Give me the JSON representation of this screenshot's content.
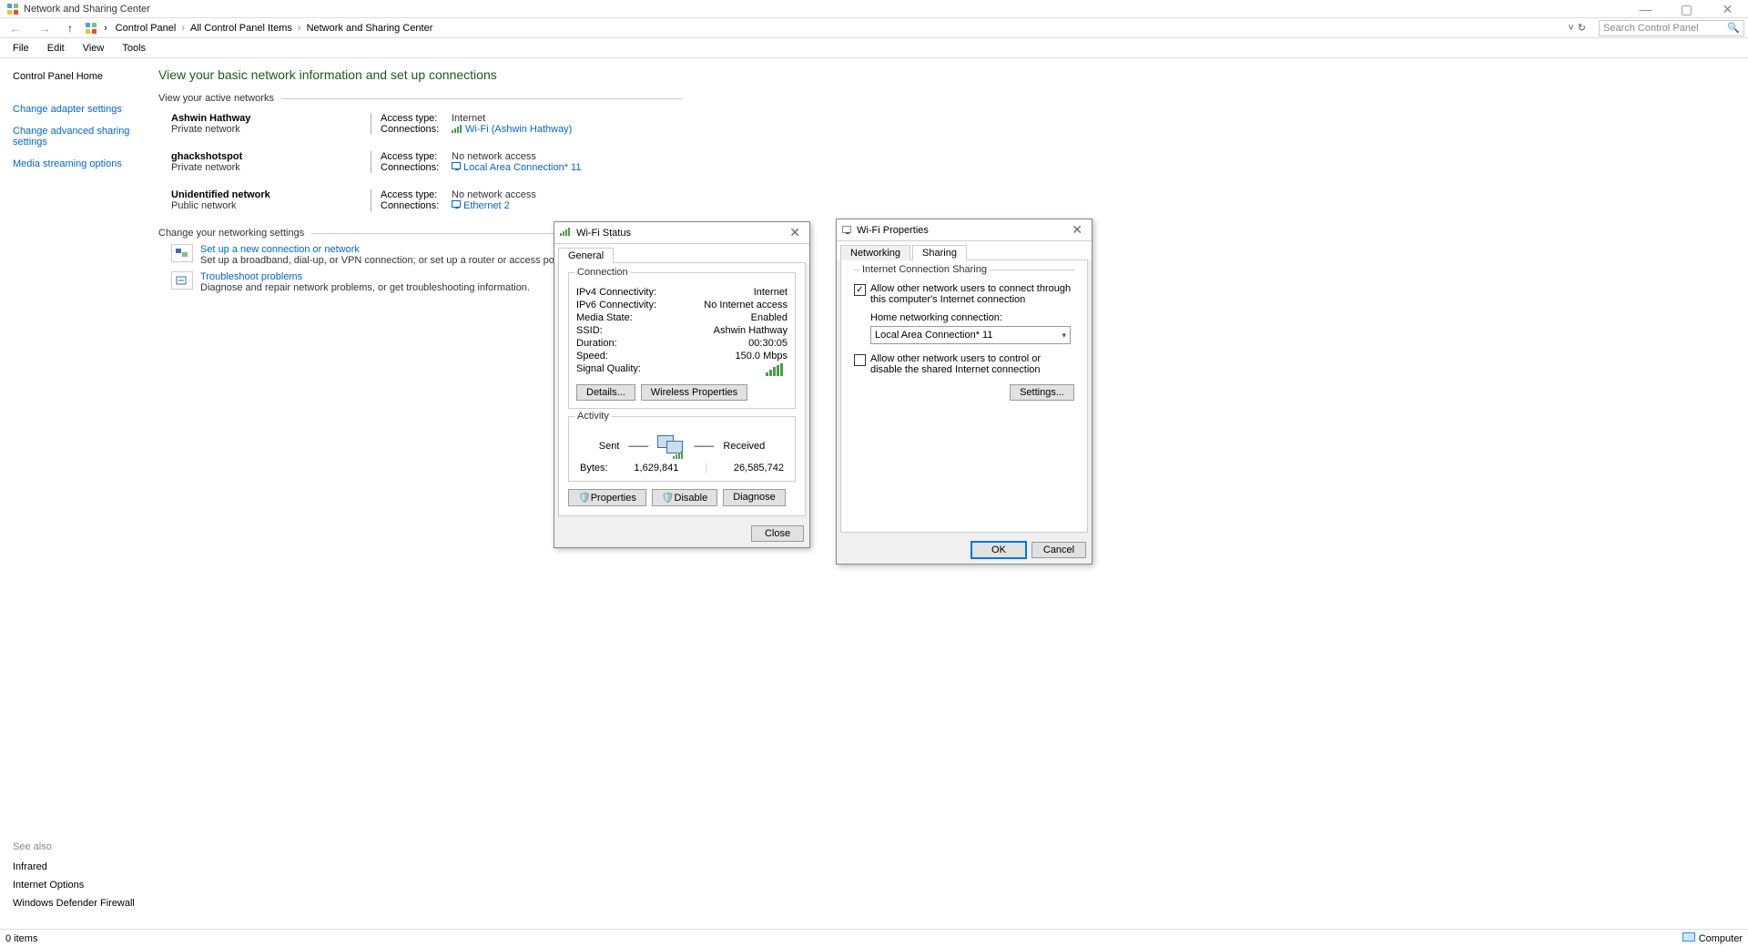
{
  "window": {
    "title": "Network and Sharing Center",
    "minimize": "—",
    "maximize": "▢",
    "close": "✕"
  },
  "breadcrumb": {
    "items": [
      "Control Panel",
      "All Control Panel Items",
      "Network and Sharing Center"
    ],
    "sep": "›",
    "refresh": "↻",
    "dropdown": "˅"
  },
  "search": {
    "placeholder": "Search Control Panel",
    "icon": "🔍"
  },
  "menubar": [
    "File",
    "Edit",
    "View",
    "Tools"
  ],
  "sidebar": {
    "home": "Control Panel Home",
    "links": [
      "Change adapter settings",
      "Change advanced sharing settings",
      "Media streaming options"
    ],
    "see_also_label": "See also",
    "see_also": [
      "Infrared",
      "Internet Options",
      "Windows Defender Firewall"
    ]
  },
  "content": {
    "heading": "View your basic network information and set up connections",
    "active_title": "View your active networks",
    "networks": [
      {
        "name": "Ashwin Hathway",
        "type": "Private network",
        "access_label": "Access type:",
        "access_value": "Internet",
        "conn_label": "Connections:",
        "conn_value": "Wi-Fi (Ashwin Hathway)",
        "conn_icon": "wifi"
      },
      {
        "name": "ghackshotspot",
        "type": "Private network",
        "access_label": "Access type:",
        "access_value": "No network access",
        "conn_label": "Connections:",
        "conn_value": "Local Area Connection* 11",
        "conn_icon": "eth"
      },
      {
        "name": "Unidentified network",
        "type": "Public network",
        "access_label": "Access type:",
        "access_value": "No network access",
        "conn_label": "Connections:",
        "conn_value": "Ethernet 2",
        "conn_icon": "eth"
      }
    ],
    "settings_title": "Change your networking settings",
    "tasks": [
      {
        "link": "Set up a new connection or network",
        "desc": "Set up a broadband, dial-up, or VPN connection; or set up a router or access point."
      },
      {
        "link": "Troubleshoot problems",
        "desc": "Diagnose and repair network problems, or get troubleshooting information."
      }
    ]
  },
  "status_dialog": {
    "title": "Wi-Fi Status",
    "tab_general": "General",
    "connection_label": "Connection",
    "rows": {
      "ipv4_l": "IPv4 Connectivity:",
      "ipv4_v": "Internet",
      "ipv6_l": "IPv6 Connectivity:",
      "ipv6_v": "No Internet access",
      "media_l": "Media State:",
      "media_v": "Enabled",
      "ssid_l": "SSID:",
      "ssid_v": "Ashwin Hathway",
      "dur_l": "Duration:",
      "dur_v": "00:30:05",
      "speed_l": "Speed:",
      "speed_v": "150.0 Mbps",
      "sig_l": "Signal Quality:"
    },
    "details_btn": "Details...",
    "wprops_btn": "Wireless Properties",
    "activity_label": "Activity",
    "sent": "Sent",
    "received": "Received",
    "bytes_l": "Bytes:",
    "bytes_sent": "1,629,841",
    "bytes_recv": "26,585,742",
    "props_btn": "Properties",
    "disable_btn": "Disable",
    "diagnose_btn": "Diagnose",
    "close_btn": "Close"
  },
  "props_dialog": {
    "title": "Wi-Fi Properties",
    "tab_networking": "Networking",
    "tab_sharing": "Sharing",
    "ics_label": "Internet Connection Sharing",
    "chk1_label": "Allow other network users to connect through this computer's Internet connection",
    "chk1_checked": true,
    "home_label": "Home networking connection:",
    "home_value": "Local Area Connection* 11",
    "chk2_label": "Allow other network users to control or disable the shared Internet connection",
    "chk2_checked": false,
    "settings_btn": "Settings...",
    "ok_btn": "OK",
    "cancel_btn": "Cancel"
  },
  "statusbar": {
    "items": "0 items",
    "computer": "Computer"
  }
}
